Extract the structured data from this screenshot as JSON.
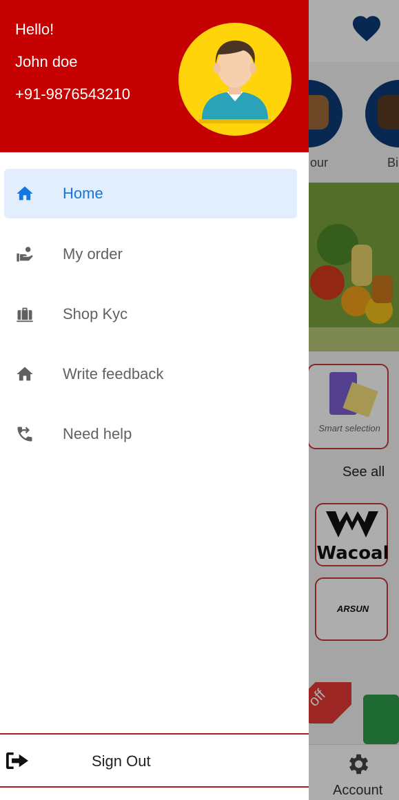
{
  "background": {
    "category_labels": [
      "our",
      "Bi"
    ],
    "card_text": "Smart selection",
    "see_all": "See all",
    "brands": [
      "Wacoal",
      "ARSUN"
    ],
    "offer_text": "off",
    "bottom_nav": {
      "account_label": "Account",
      "account_icon": "gear-icon"
    },
    "heart_icon": "heart-icon"
  },
  "drawer": {
    "header": {
      "greeting": "Hello!",
      "name": "John doe",
      "phone": "+91-9876543210",
      "bg_color": "#c40000",
      "avatar_bg": "#ffd40a"
    },
    "menu": [
      {
        "label": "Home",
        "icon": "home-icon",
        "active": true
      },
      {
        "label": "My order",
        "icon": "hand-user-icon",
        "active": false
      },
      {
        "label": "Shop Kyc",
        "icon": "briefcase-icon",
        "active": false
      },
      {
        "label": "Write feedback",
        "icon": "home-icon",
        "active": false
      },
      {
        "label": "Need help",
        "icon": "phone-forward-icon",
        "active": false
      }
    ],
    "signout": {
      "label": "Sign Out",
      "icon": "logout-icon"
    },
    "active_color": "#1476e0",
    "divider_color": "#b51a1a"
  }
}
